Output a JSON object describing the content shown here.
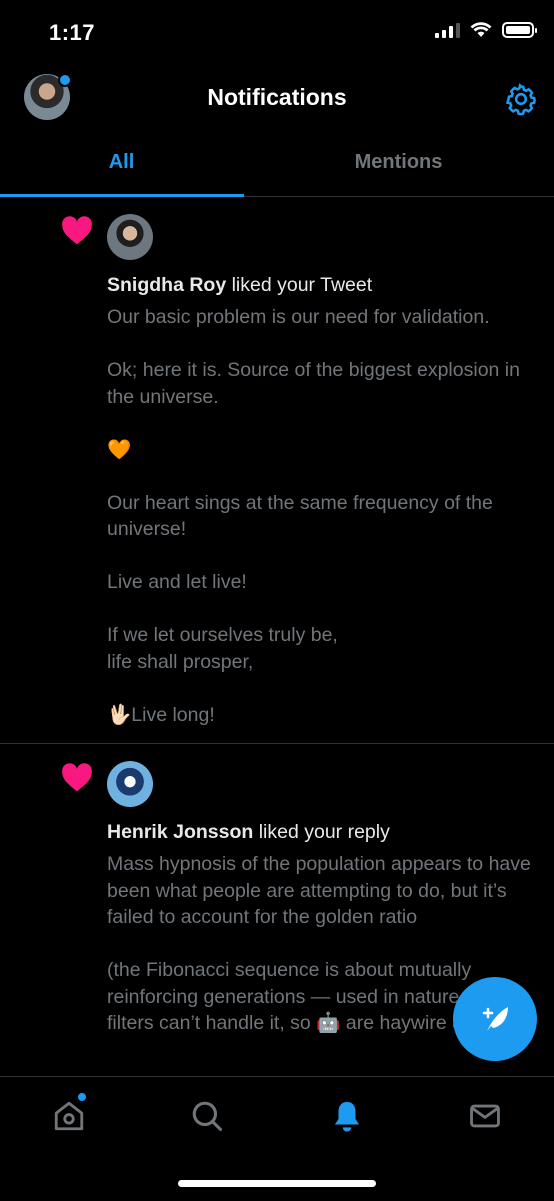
{
  "status_bar": {
    "time": "1:17"
  },
  "header": {
    "title": "Notifications"
  },
  "tabs": [
    {
      "label": "All",
      "active": true
    },
    {
      "label": "Mentions",
      "active": false
    }
  ],
  "notifications": [
    {
      "icon": "heart-icon",
      "user": "Snigdha Roy",
      "action": " liked your Tweet",
      "text": "Our basic problem is our need for validation.\n\nOk; here it is. Source of the biggest explosion in the universe.\n\n                    🧡\n\nOur heart sings at the same frequency of the universe!\n\nLive and let live!\n\nIf we let ourselves truly be,\nlife shall prosper,\n\n🖖🏻Live long!"
    },
    {
      "icon": "heart-icon",
      "user": "Henrik Jonsson",
      "action": " liked your reply",
      "text": "Mass hypnosis of the population appears to have been what people are attempting to do, but it’s failed to account for the golden ratio\n\n(the Fibonacci sequence is about mutually reinforcing generations — used in nature, digital filters can’t handle it, so 🤖 are haywire & fuxed"
    }
  ],
  "colors": {
    "accent": "#1d9bf0",
    "heart": "#f91880",
    "muted": "#71767b",
    "background": "#000000"
  },
  "tab_bar": {
    "items": [
      "home-icon",
      "search-icon",
      "notifications-bell-icon",
      "messages-envelope-icon"
    ],
    "active": "notifications-bell-icon"
  },
  "fab": {
    "icon": "compose-feather-icon"
  }
}
